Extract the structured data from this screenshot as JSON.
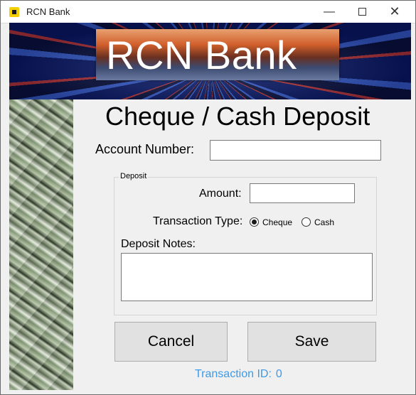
{
  "window": {
    "title": "RCN Bank",
    "controls": {
      "minimize": "—",
      "close": "✕"
    }
  },
  "banner": {
    "logo_text": "RCN Bank"
  },
  "form": {
    "heading": "Cheque / Cash Deposit",
    "account_label": "Account Number:",
    "account_value": "",
    "deposit_group": {
      "title": "Deposit",
      "amount_label": "Amount:",
      "amount_value": "",
      "transaction_type_label": "Transaction Type:",
      "transaction_types": [
        {
          "label": "Cheque",
          "selected": true
        },
        {
          "label": "Cash",
          "selected": false
        }
      ],
      "notes_label": "Deposit Notes:",
      "notes_value": ""
    },
    "cancel_label": "Cancel",
    "save_label": "Save",
    "transaction_id_label": "Transaction ID:",
    "transaction_id_value": "0"
  },
  "colors": {
    "accent_text": "#3d9ae8",
    "app_icon": "#f5d000"
  }
}
